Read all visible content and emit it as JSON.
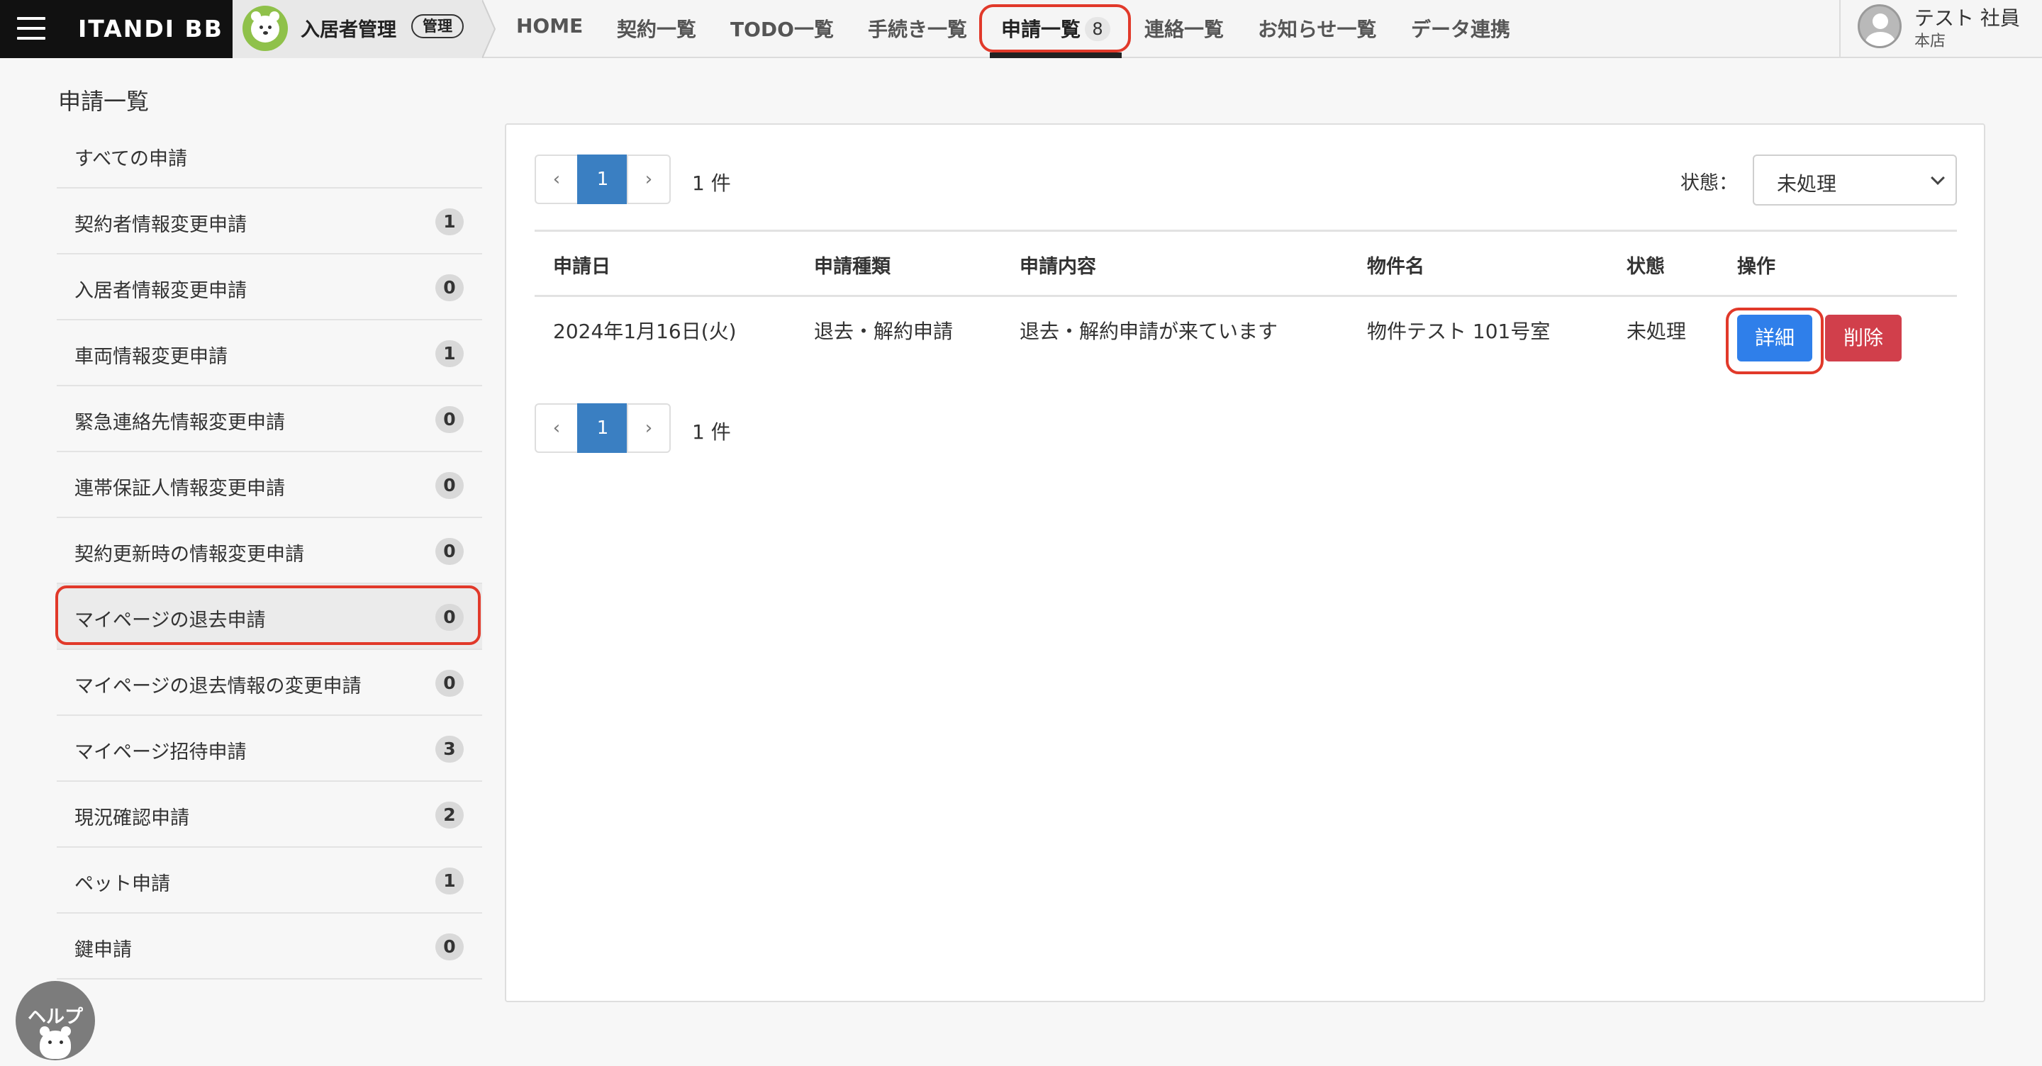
{
  "brand": {
    "name": "ITANDI BB"
  },
  "product": {
    "name": "入居者管理",
    "badge": "管理"
  },
  "nav": {
    "home": "HOME",
    "contracts": "契約一覧",
    "todo": "TODO一覧",
    "procedures": "手続き一覧",
    "applications": "申請一覧",
    "applications_count": "8",
    "contacts": "連絡一覧",
    "notices": "お知らせ一覧",
    "data_link": "データ連携"
  },
  "user": {
    "name": "テスト 社員",
    "branch": "本店"
  },
  "page": {
    "title": "申請一覧"
  },
  "sidebar": {
    "items": [
      {
        "label": "すべての申請",
        "count": ""
      },
      {
        "label": "契約者情報変更申請",
        "count": "1"
      },
      {
        "label": "入居者情報変更申請",
        "count": "0"
      },
      {
        "label": "車両情報変更申請",
        "count": "1"
      },
      {
        "label": "緊急連絡先情報変更申請",
        "count": "0"
      },
      {
        "label": "連帯保証人情報変更申請",
        "count": "0"
      },
      {
        "label": "契約更新時の情報変更申請",
        "count": "0"
      },
      {
        "label": "マイページの退去申請",
        "count": "0"
      },
      {
        "label": "マイページの退去情報の変更申請",
        "count": "0"
      },
      {
        "label": "マイページ招待申請",
        "count": "3"
      },
      {
        "label": "現況確認申請",
        "count": "2"
      },
      {
        "label": "ペット申請",
        "count": "1"
      },
      {
        "label": "鍵申請",
        "count": "0"
      }
    ],
    "active_index": 7
  },
  "pagination": {
    "prev": "‹",
    "current": "1",
    "next": "›",
    "total_text": "1 件"
  },
  "filter": {
    "label": "状態：",
    "value": "未処理"
  },
  "table": {
    "headers": [
      "申請日",
      "申請種類",
      "申請内容",
      "物件名",
      "状態",
      "操作"
    ],
    "rows": [
      {
        "date": "2024年1月16日(火)",
        "type": "退去・解約申請",
        "content": "退去・解約申請が来ています",
        "property": "物件テスト 101号室",
        "status": "未処理",
        "detail_label": "詳細",
        "delete_label": "削除"
      }
    ]
  },
  "help": {
    "label": "ヘルプ"
  },
  "colors": {
    "accent_blue": "#3a7fc2",
    "detail_button": "#2f7fea",
    "delete_button": "#d13f4b",
    "highlight": "#e1392a"
  }
}
